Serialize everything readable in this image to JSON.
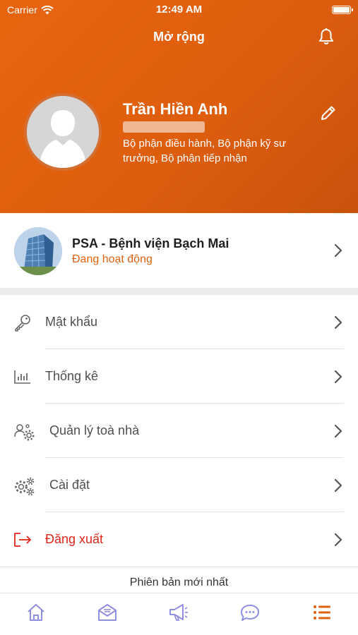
{
  "status_bar": {
    "carrier": "Carrier",
    "time": "12:49 AM"
  },
  "header": {
    "title": "Mở rộng"
  },
  "profile": {
    "name": "Trần Hiền Anh",
    "departments": "Bộ phận điều hành, Bộ phận kỹ sư trưởng, Bộ phận tiếp nhận"
  },
  "organization": {
    "name": "PSA - Bệnh viện Bạch Mai",
    "status": "Đang hoạt động"
  },
  "menu": [
    {
      "label": "Mật khẩu",
      "icon": "key-icon"
    },
    {
      "label": "Thống kê",
      "icon": "bar-chart-icon"
    },
    {
      "label": "Quản lý toà nhà",
      "icon": "user-settings-icon"
    },
    {
      "label": "Cài đặt",
      "icon": "gears-icon"
    },
    {
      "label": "Đăng xuất",
      "icon": "logout-icon"
    }
  ],
  "footer": {
    "version_text": "Phiên bản mới nhất"
  },
  "tabs": [
    "home-icon",
    "mail-icon",
    "megaphone-icon",
    "chat-icon",
    "list-icon"
  ],
  "colors": {
    "accent": "#e8650f",
    "danger": "#e0261a",
    "tab_inactive": "#8f8fe0",
    "tab_active": "#e06210"
  }
}
